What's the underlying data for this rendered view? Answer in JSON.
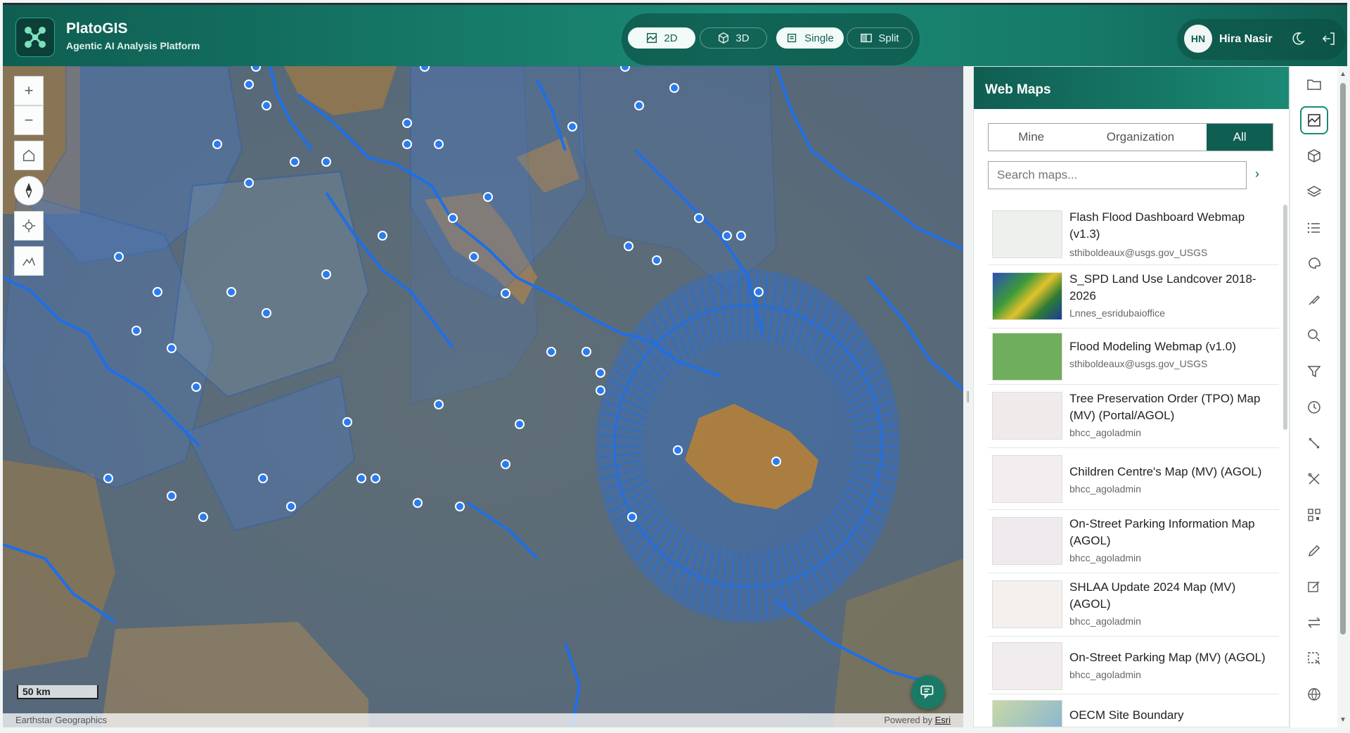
{
  "app": {
    "title": "PlatoGIS",
    "subtitle": "Agentic AI Analysis Platform"
  },
  "view_toggle": {
    "labels": [
      "2D",
      "3D",
      "Single",
      "Split"
    ],
    "active": [
      "2D",
      "Single"
    ]
  },
  "user": {
    "initials": "HN",
    "name": "Hira Nasir"
  },
  "map": {
    "scale_label": "50 km",
    "attribution_left": "Earthstar Geographics",
    "attribution_right_prefix": "Powered by ",
    "attribution_right_link": "Esri"
  },
  "panel": {
    "title": "Web Maps",
    "filters": [
      "Mine",
      "Organization",
      "All"
    ],
    "active_filter": "All",
    "search_placeholder": "Search maps...",
    "items": [
      {
        "title": "Flash Flood Dashboard Webmap (v1.3)",
        "owner": "sthiboldeaux@usgs.gov_USGS"
      },
      {
        "title": "S_SPD Land Use Landcover 2018-2026",
        "owner": "Lnnes_esridubaioffice"
      },
      {
        "title": "Flood Modeling Webmap (v1.0)",
        "owner": "sthiboldeaux@usgs.gov_USGS"
      },
      {
        "title": "Tree Preservation Order (TPO) Map (MV) (Portal/AGOL)",
        "owner": "bhcc_agoladmin"
      },
      {
        "title": "Children Centre's Map (MV) (AGOL)",
        "owner": "bhcc_agoladmin"
      },
      {
        "title": "On-Street Parking Information Map (AGOL)",
        "owner": "bhcc_agoladmin"
      },
      {
        "title": "SHLAA Update 2024 Map (MV) (AGOL)",
        "owner": "bhcc_agoladmin"
      },
      {
        "title": "On-Street Parking Map (MV) (AGOL)",
        "owner": "bhcc_agoladmin"
      },
      {
        "title": "OECM Site Boundary",
        "owner": ""
      }
    ]
  },
  "toolbar_icons": [
    "folder-icon",
    "webmap-icon",
    "cube-icon",
    "layers-icon",
    "list-icon",
    "palette-icon",
    "pen-tool-icon",
    "search-icon",
    "filter-icon",
    "clock-icon",
    "measure-icon",
    "tools-icon",
    "qr-icon",
    "pencil-icon",
    "edit-icon",
    "swap-icon",
    "select-icon",
    "globe-icon"
  ],
  "colors": {
    "brand": "#0f5e52",
    "accent": "#1b8a75",
    "water": "#1e6fe8"
  }
}
